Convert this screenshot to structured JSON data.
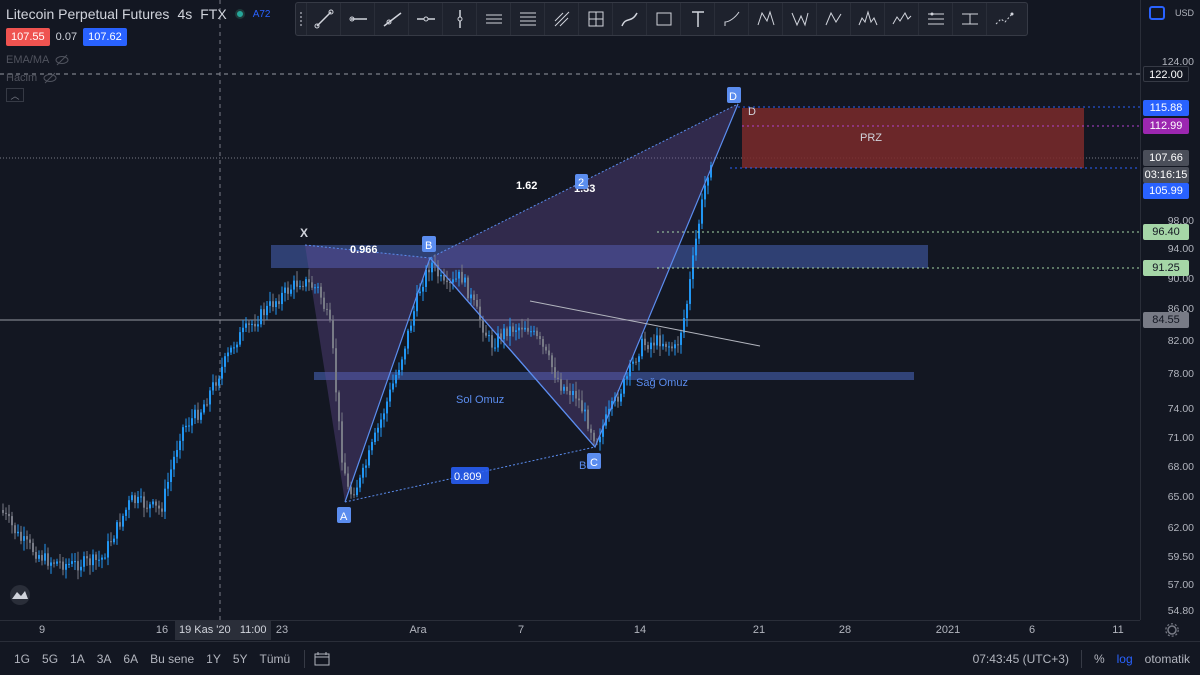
{
  "header": {
    "symbol": "Litecoin Perpetual Futures",
    "interval": "4s",
    "exchange": "FTX",
    "bid": "107.55",
    "spread": "0.07",
    "ask": "107.62",
    "indicators": [
      "EMA/MA",
      "Hacim"
    ],
    "a_label": "A72"
  },
  "price_axis": {
    "currency": "USD",
    "ticks": [
      "124.00",
      "98.00",
      "94.00",
      "90.00",
      "86.00",
      "82.00",
      "78.00",
      "74.00",
      "71.00",
      "68.00",
      "65.00",
      "62.00",
      "59.50",
      "57.00",
      "54.80"
    ],
    "tags": [
      {
        "label": "122.00",
        "color": "#131722",
        "text": "#ffffff"
      },
      {
        "label": "115.88",
        "color": "#2962ff",
        "text": "#ffffff"
      },
      {
        "label": "112.99",
        "color": "#9c27b0",
        "text": "#ffffff"
      },
      {
        "label": "107.66",
        "color": "#4a4e59",
        "text": "#ffffff"
      },
      {
        "label": "03:16:15",
        "color": "#4a4e59",
        "text": "#ffffff"
      },
      {
        "label": "105.99",
        "color": "#2962ff",
        "text": "#ffffff"
      },
      {
        "label": "96.40",
        "color": "#a5d6a7",
        "text": "#131722"
      },
      {
        "label": "91.25",
        "color": "#a5d6a7",
        "text": "#131722"
      },
      {
        "label": "84.55",
        "color": "#787b86",
        "text": "#131722"
      }
    ]
  },
  "time_axis": {
    "ticks": [
      "9",
      "16",
      "23",
      "Ara",
      "7",
      "14",
      "21",
      "28",
      "2021",
      "6",
      "11"
    ],
    "crosshair_date": "19 Kas '20",
    "crosshair_time": "11:00"
  },
  "pattern": {
    "points": [
      "X",
      "A",
      "B",
      "C",
      "D"
    ],
    "ratios": {
      "xb": "0.966",
      "ac": "0.809",
      "bd": "1.62",
      "cd": "1.33"
    },
    "prz_label": "PRZ",
    "d_label": "D",
    "c_sub": "B",
    "marker_2": "2",
    "left_shoulder": "Sol Omuz",
    "right_shoulder": "Sağ Omuz"
  },
  "bottom_bar": {
    "ranges": [
      "1G",
      "5G",
      "1A",
      "3A",
      "6A",
      "Bu sene",
      "1Y",
      "5Y",
      "Tümü"
    ],
    "clock": "07:43:45 (UTC+3)",
    "percent": "%",
    "log": "log",
    "auto": "otomatik"
  },
  "toolbar_icons": [
    "trend-line-icon",
    "horizontal-ray-icon",
    "ray-icon",
    "horizontal-line-icon",
    "vertical-line-icon",
    "parallel-channel-icon",
    "fib-retracement-icon",
    "pitchfork-icon",
    "gann-box-icon",
    "brush-icon",
    "rectangle-icon",
    "text-icon",
    "arc-icon",
    "xabcd-pattern-icon",
    "cypher-pattern-icon",
    "abcd-pattern-icon",
    "head-shoulders-icon",
    "elliott-wave-icon",
    "long-position-icon",
    "price-range-icon",
    "forecast-icon"
  ],
  "colors": {
    "up": "#2196f3",
    "down": "#787b86",
    "accent": "#2962ff",
    "prz": "#8b2d2d"
  }
}
